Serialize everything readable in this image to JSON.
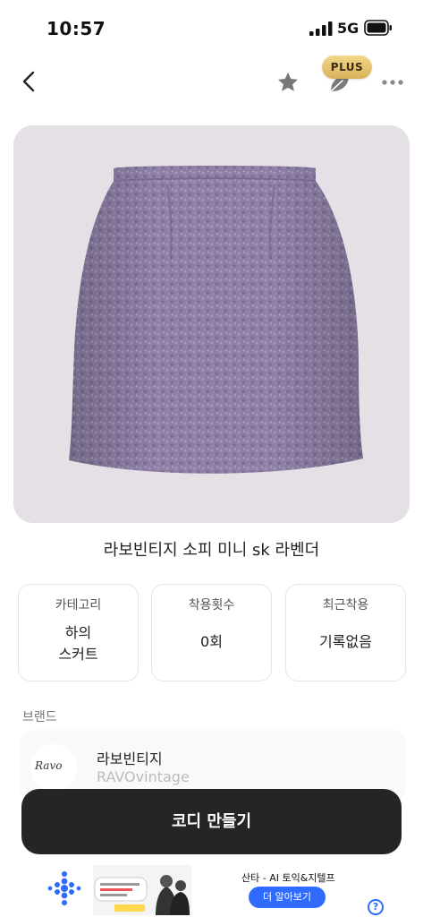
{
  "status_bar": {
    "time": "10:57",
    "network": "5G"
  },
  "nav": {
    "plus_badge": "PLUS",
    "icons": [
      "chevron-left-icon",
      "star-icon",
      "leaf-icon",
      "more-icon"
    ]
  },
  "item": {
    "title": "라보빈티지 소피 미니 sk 라벤더",
    "image": "lavender-tweed-mini-skirt"
  },
  "info": [
    {
      "label": "카테고리",
      "value_line1": "하의",
      "value_line2": "스커트"
    },
    {
      "label": "착용횟수",
      "value": "0회"
    },
    {
      "label": "최근착용",
      "value": "기록없음"
    }
  ],
  "brand": {
    "section_label": "브랜드",
    "logo_text": "Ravo",
    "name": "라보빈티지",
    "name_en": "RAVOvintage"
  },
  "cta": {
    "label": "코디 만들기"
  },
  "ad": {
    "title": "산타 - AI 토익&지텔프",
    "button": "더 알아보기",
    "help": "?"
  },
  "colors": {
    "accent_gold": "#e3c06f",
    "cta_bg": "#272523",
    "ad_blue": "#2f6bff",
    "card_bg": "#e4e0e6",
    "skirt": "#8e7fa6"
  }
}
